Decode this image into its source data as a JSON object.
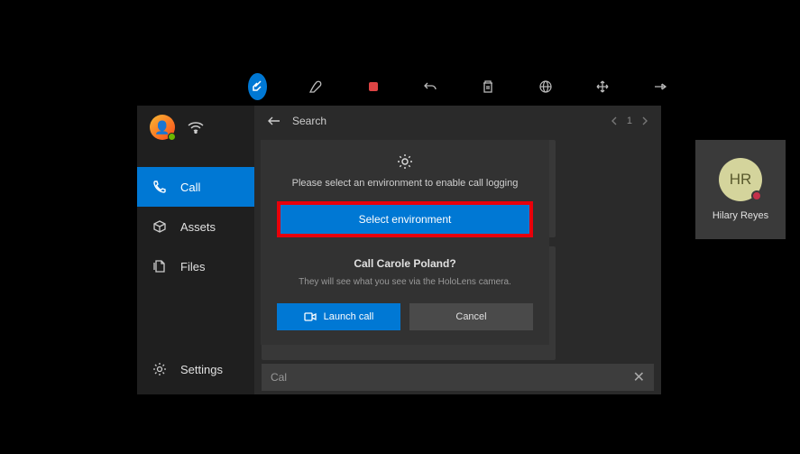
{
  "toolbar": {
    "icons": [
      "ink-ingress",
      "pen",
      "stop-record",
      "undo",
      "delete",
      "globe",
      "move",
      "pin"
    ]
  },
  "sidebar": {
    "items": [
      {
        "icon": "phone",
        "label": "Call"
      },
      {
        "icon": "package",
        "label": "Assets"
      },
      {
        "icon": "files",
        "label": "Files"
      }
    ],
    "settings_label": "Settings"
  },
  "main": {
    "search_label": "Search",
    "page_current": "1",
    "search_input_value": "Cal"
  },
  "contact": {
    "initials": "HR",
    "name": "Hilary Reyes"
  },
  "modal": {
    "env_text": "Please select an environment to enable call logging",
    "select_env_label": "Select environment",
    "question": "Call Carole Poland?",
    "subtext": "They will see what you see via the HoloLens camera.",
    "launch_label": "Launch call",
    "cancel_label": "Cancel"
  }
}
